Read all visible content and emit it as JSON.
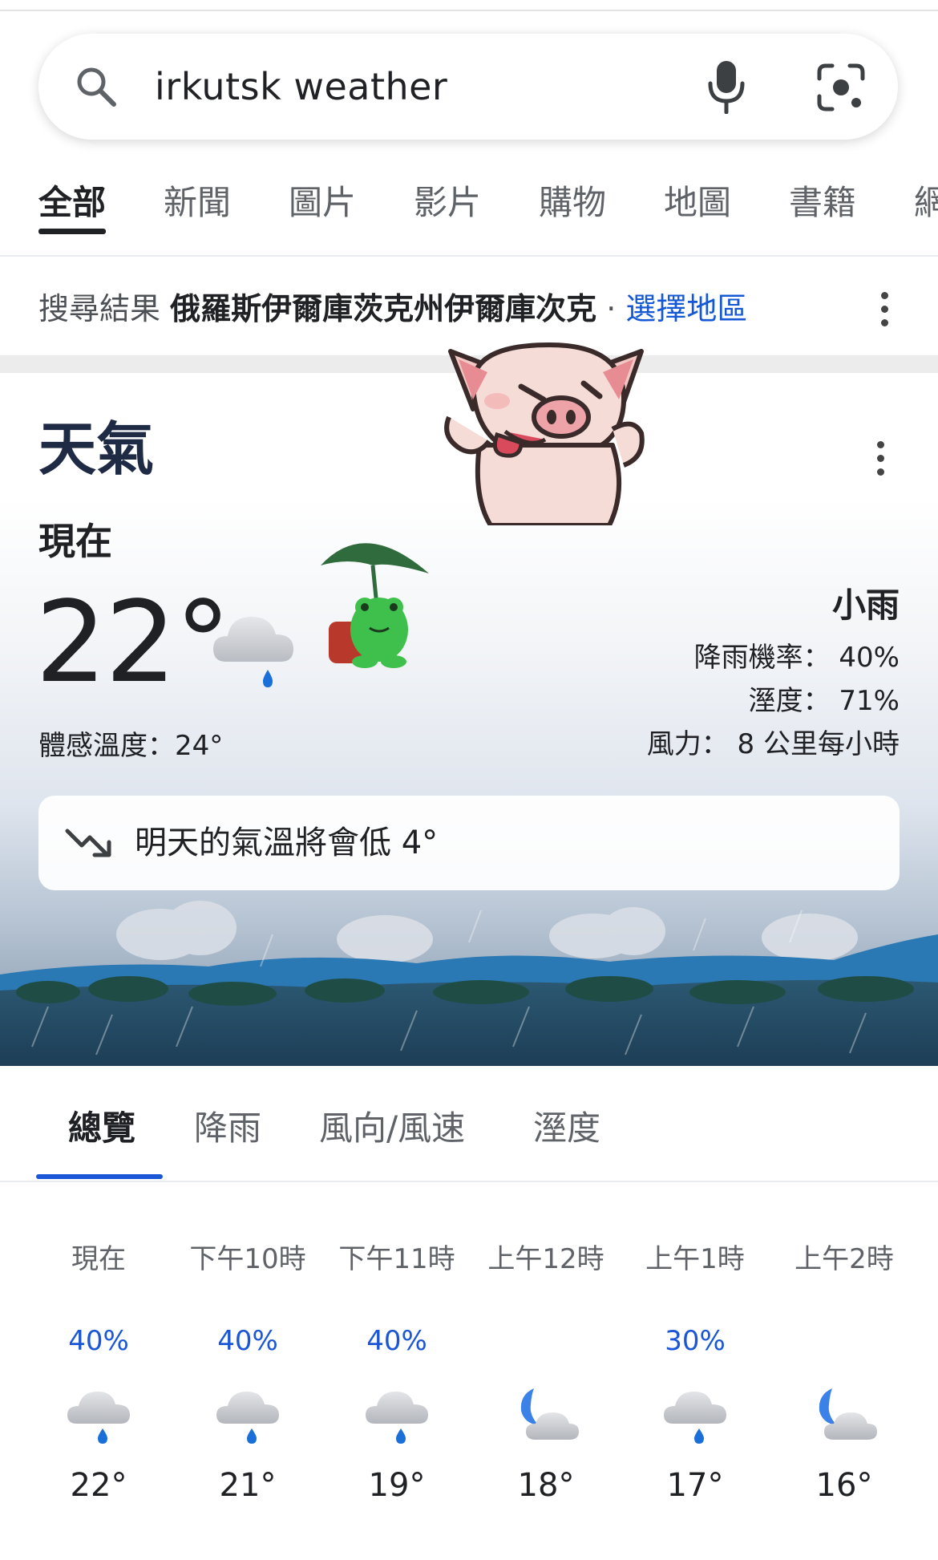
{
  "search": {
    "query": "irkutsk weather",
    "icons": [
      "search-icon",
      "mic-icon",
      "lens-icon"
    ]
  },
  "tabs": [
    {
      "label": "全部",
      "active": true
    },
    {
      "label": "新聞"
    },
    {
      "label": "圖片"
    },
    {
      "label": "影片"
    },
    {
      "label": "購物"
    },
    {
      "label": "地圖"
    },
    {
      "label": "書籍"
    },
    {
      "label": "網"
    }
  ],
  "location": {
    "prefix": "搜尋結果",
    "place": "俄羅斯伊爾庫茨克州伊爾庫次克",
    "separator": "·",
    "change_link": "選擇地區"
  },
  "weather": {
    "title": "天氣",
    "now_label": "現在",
    "temp": "22°",
    "feels_like": "體感溫度：24°",
    "condition": "小雨",
    "precip": "降雨機率： 40%",
    "humidity": "溼度： 71%",
    "wind": "風力： 8 公里每小時",
    "trend": "明天的氣溫將會低 4°",
    "icon": "light-rain-icon"
  },
  "detail_tabs": [
    {
      "label": "總覽",
      "active": true
    },
    {
      "label": "降雨"
    },
    {
      "label": "風向/風速"
    },
    {
      "label": "溼度"
    }
  ],
  "hourly": [
    {
      "time": "現在",
      "precip": "40%",
      "icon": "rain-icon",
      "temp": "22°"
    },
    {
      "time": "下午10時",
      "precip": "40%",
      "icon": "rain-icon",
      "temp": "21°"
    },
    {
      "time": "下午11時",
      "precip": "40%",
      "icon": "rain-icon",
      "temp": "19°"
    },
    {
      "time": "上午12時",
      "precip": "",
      "icon": "night-cloudy-icon",
      "temp": "18°"
    },
    {
      "time": "上午1時",
      "precip": "30%",
      "icon": "rain-icon",
      "temp": "17°"
    },
    {
      "time": "上午2時",
      "precip": "",
      "icon": "night-cloudy-icon",
      "temp": "16°"
    }
  ],
  "colors": {
    "link_blue": "#1558d6",
    "accent_blue": "#1a56d6",
    "title_navy": "#1f2a44"
  }
}
